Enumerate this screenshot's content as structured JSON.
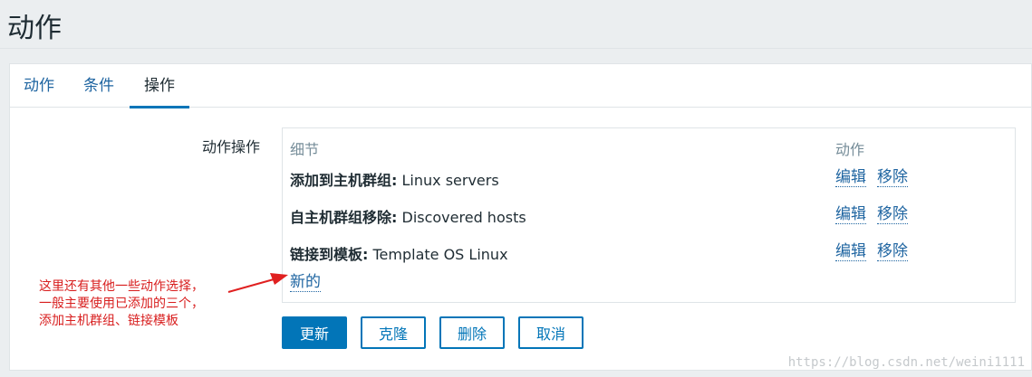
{
  "page": {
    "title": "动作"
  },
  "tabs": [
    {
      "label": "动作",
      "active": false
    },
    {
      "label": "条件",
      "active": false
    },
    {
      "label": "操作",
      "active": true
    }
  ],
  "form": {
    "label": "动作操作",
    "table": {
      "col_details": "细节",
      "col_action": "动作",
      "rows": [
        {
          "key": "添加到主机群组:",
          "value": " Linux servers",
          "edit": "编辑",
          "remove": "移除"
        },
        {
          "key": "自主机群组移除:",
          "value": " Discovered hosts",
          "edit": "编辑",
          "remove": "移除"
        },
        {
          "key": "链接到模板:",
          "value": " Template OS Linux",
          "edit": "编辑",
          "remove": "移除"
        }
      ],
      "new_link": "新的"
    }
  },
  "buttons": {
    "update": "更新",
    "clone": "克隆",
    "delete": "删除",
    "cancel": "取消"
  },
  "annotation": {
    "line1": "这里还有其他一些动作选择，",
    "line2": "一般主要使用已添加的三个，",
    "line3": "添加主机群组、链接模板"
  },
  "watermark": "https://blog.csdn.net/weini1111",
  "colors": {
    "accent": "#0275b8",
    "link": "#1f65a1",
    "annotation": "#d81e1e",
    "background": "#ebeef0"
  }
}
